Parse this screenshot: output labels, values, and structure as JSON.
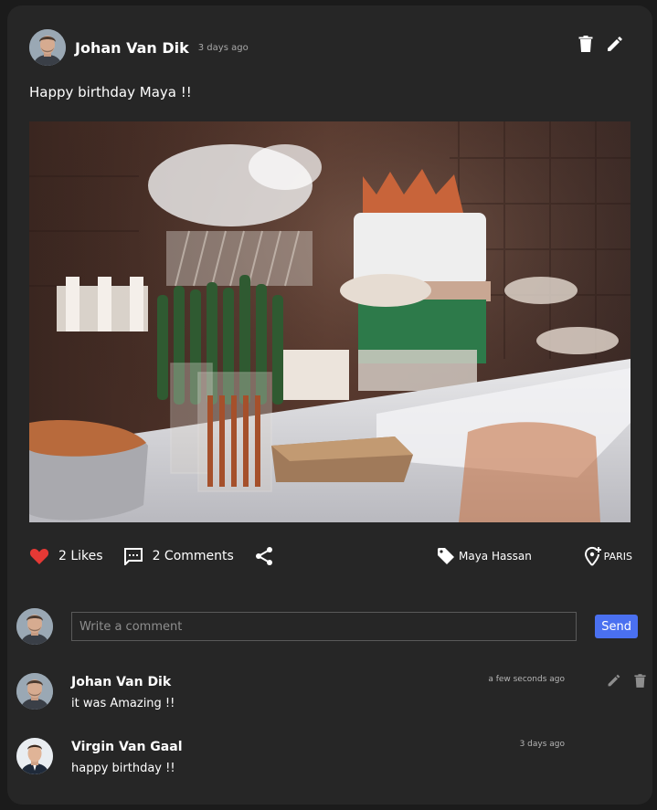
{
  "post": {
    "author": "Johan Van Dik",
    "time": "3 days ago",
    "text": "Happy birthday Maya !!",
    "icons": [
      "trash-icon",
      "pencil-icon"
    ]
  },
  "actions": {
    "likes": "2 Likes",
    "comments": "2 Comments",
    "tagged": "Maya Hassan",
    "place": "PARIS",
    "icons": [
      "heart-icon",
      "comment-icon",
      "share-icon",
      "tag-icon",
      "location-add-icon"
    ]
  },
  "composer": {
    "placeholder": "Write a comment",
    "send_label": "Send"
  },
  "comments": [
    {
      "author": "Johan Van Dik",
      "text": "it was Amazing !!",
      "time": "a few seconds ago"
    },
    {
      "author": "Virgin Van Gaal",
      "text": "happy birthday !!",
      "time": "3 days ago"
    }
  ],
  "colors": {
    "background": "#1b1b1b",
    "card": "#262626",
    "like": "#e53935",
    "send_button": "#4a70f0",
    "muted_text": "#a8a8a8"
  }
}
